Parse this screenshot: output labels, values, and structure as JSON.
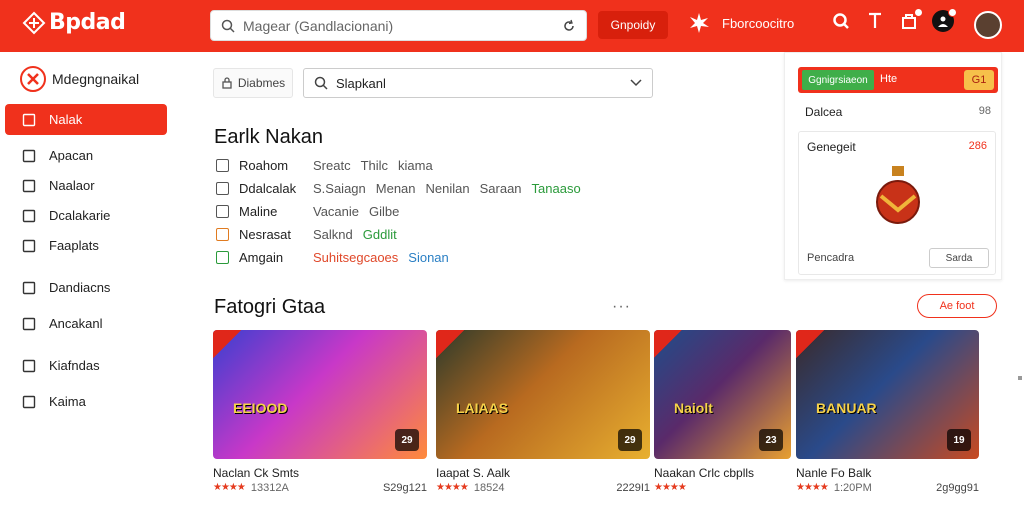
{
  "app": {
    "name": "Bpdad",
    "search_placeholder": "Magear (Gandlacionani)",
    "top_button": "Gnpoidy",
    "top_link": "Fborcoocitro"
  },
  "sidebar": {
    "brand": "Mdegngnaikal",
    "items": [
      {
        "label": "Nalak",
        "icon": "home-icon",
        "active": true
      },
      {
        "label": "Apacan",
        "icon": "list-icon"
      },
      {
        "label": "Naalaor",
        "icon": "grid-icon"
      },
      {
        "label": "Dcalakarie",
        "icon": "check-icon"
      },
      {
        "label": "Faaplats",
        "icon": "search-icon"
      },
      {
        "label": "Dandiacns",
        "icon": "bag-icon"
      },
      {
        "label": "Ancakanl",
        "icon": "box-icon"
      },
      {
        "label": "Kiafndas",
        "icon": "user-icon"
      },
      {
        "label": "Kaima",
        "icon": "pin-icon"
      }
    ]
  },
  "toolbar": {
    "filter_label": "Diabmes",
    "select_value": "Slapkanl"
  },
  "filters": {
    "title": "Earlk Nakan",
    "rows": [
      {
        "label": "Roahom",
        "values": [
          "Sreatc",
          "Thilc",
          "kiama"
        ],
        "colors": [
          "#555",
          "#555",
          "#555"
        ],
        "icon_color": "#555"
      },
      {
        "label": "Ddalcalak",
        "values": [
          "S.Saiagn",
          "Menan",
          "Nenilan",
          "Saraan",
          "Tanaaso"
        ],
        "colors": [
          "#555",
          "#555",
          "#555",
          "#555",
          "#2a9a3a"
        ],
        "icon_color": "#555"
      },
      {
        "label": "Maline",
        "values": [
          "Vacanie",
          "Gilbe"
        ],
        "colors": [
          "#555",
          "#555"
        ],
        "icon_color": "#555"
      },
      {
        "label": "Nesrasat",
        "values": [
          "Salknd",
          "Gddlit"
        ],
        "colors": [
          "#555",
          "#2a9a3a"
        ],
        "icon_color": "#e07b20"
      },
      {
        "label": "Amgain",
        "values": [
          "Suhitsegcaoes",
          "Sionan"
        ],
        "colors": [
          "#e0482a",
          "#2a7fc4"
        ],
        "icon_color": "#2a9a3a"
      }
    ]
  },
  "games": {
    "title": "Fatogri Gtaa",
    "more": "···",
    "view_all": "Ae foot",
    "cards": [
      {
        "title": "Naclan Ck Smts",
        "stars": "★★★★",
        "meta": "13312A",
        "price": "S29g121",
        "badge": "29",
        "thumb_text": "EEIOOD",
        "colors": [
          "#3a3fd0",
          "#ff8a3a",
          "#c838c8"
        ]
      },
      {
        "title": "Iaapat S. Aalk",
        "stars": "★★★★",
        "meta": "18524",
        "price": "2229I1",
        "badge": "29",
        "thumb_text": "LAIAAS",
        "colors": [
          "#2d3a2a",
          "#e8b030",
          "#b86a20"
        ]
      },
      {
        "title": "Naakan Crlc cbplls",
        "stars": "★★★★",
        "meta": "",
        "price": "",
        "badge": "23",
        "thumb_text": "Naiolt",
        "colors": [
          "#1f4d8a",
          "#e8a030",
          "#5a2a6a"
        ]
      },
      {
        "title": "Nanle Fo Balk",
        "stars": "★★★★",
        "meta": "1:20PM",
        "price": "2g9gg91",
        "badge": "19",
        "thumb_text": "BANUAR",
        "colors": [
          "#3a2a2a",
          "#c84a20",
          "#2a4a8a"
        ]
      }
    ]
  },
  "panel": {
    "green_label": "Ggnigrsiaeon",
    "red_text": "Hte",
    "count": "G1",
    "row_label": "Dalcea",
    "row_value": "98",
    "box_title": "Genegeit",
    "box_badge": "286",
    "box_footer": "Pencadra",
    "box_button": "Sarda"
  }
}
